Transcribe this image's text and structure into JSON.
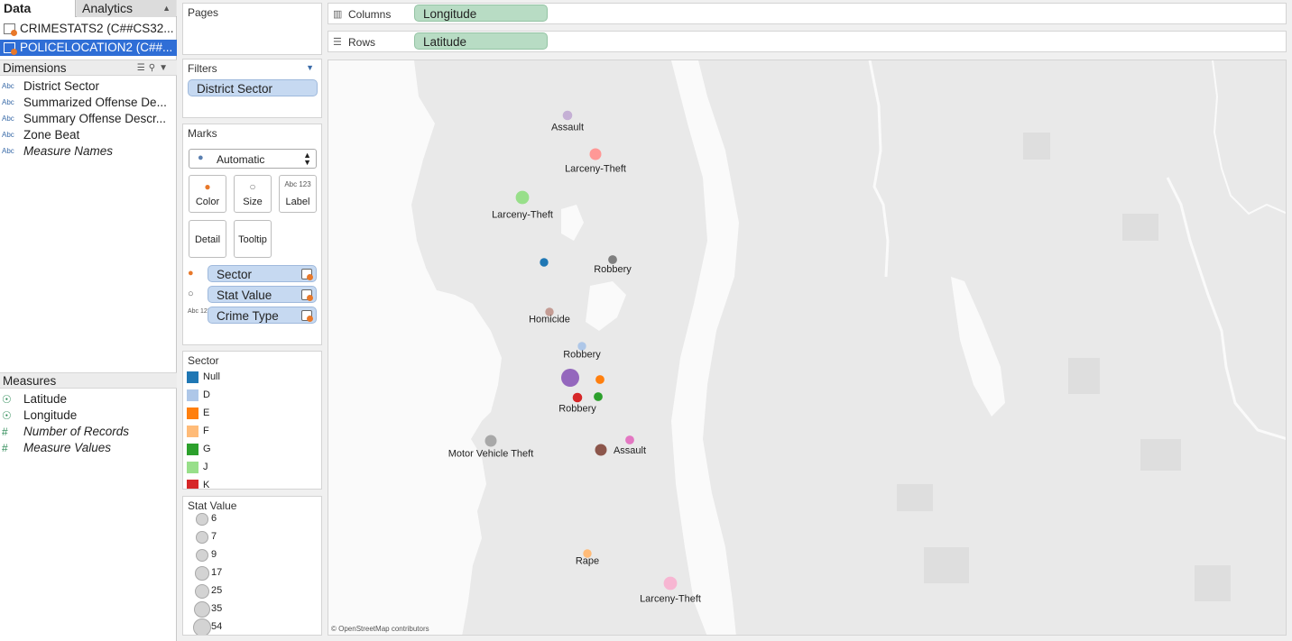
{
  "tabs": {
    "data": "Data",
    "analytics": "Analytics"
  },
  "datasources": [
    "CRIMESTATS2 (C##CS32...",
    "POLICELOCATION2 (C##..."
  ],
  "dimensions": {
    "header": "Dimensions",
    "items": [
      {
        "type": "Abc",
        "label": "District Sector"
      },
      {
        "type": "Abc",
        "label": "Summarized Offense De..."
      },
      {
        "type": "Abc",
        "label": "Summary Offense Descr..."
      },
      {
        "type": "Abc",
        "label": "Zone Beat"
      },
      {
        "type": "Abc",
        "label": "Measure Names"
      }
    ]
  },
  "measures": {
    "header": "Measures",
    "items": [
      {
        "type": "globe",
        "label": "Latitude"
      },
      {
        "type": "globe",
        "label": "Longitude"
      },
      {
        "type": "#",
        "label": "Number of Records"
      },
      {
        "type": "#",
        "label": "Measure Values"
      }
    ]
  },
  "pages": {
    "title": "Pages"
  },
  "filters": {
    "title": "Filters",
    "pill": "District Sector"
  },
  "marks": {
    "title": "Marks",
    "type": "Automatic",
    "buttons": [
      "Color",
      "Size",
      "Label",
      "Detail",
      "Tooltip"
    ],
    "label_icon": "Abc 123",
    "shelf": [
      {
        "icon": "color-icon",
        "label": "Sector"
      },
      {
        "icon": "size-icon",
        "label": "Stat Value"
      },
      {
        "icon": "Abc 123",
        "label": "Crime Type"
      }
    ]
  },
  "sector_legend": {
    "title": "Sector",
    "items": [
      {
        "label": "Null",
        "color": "#1f77b4"
      },
      {
        "label": "D",
        "color": "#aec7e8"
      },
      {
        "label": "E",
        "color": "#ff7f0e"
      },
      {
        "label": "F",
        "color": "#ffbb78"
      },
      {
        "label": "G",
        "color": "#2ca02c"
      },
      {
        "label": "J",
        "color": "#98df8a"
      },
      {
        "label": "K",
        "color": "#d62728"
      }
    ]
  },
  "size_legend": {
    "title": "Stat Value",
    "items": [
      "6",
      "7",
      "9",
      "17",
      "25",
      "35",
      "54"
    ]
  },
  "shelves": {
    "columns_label": "Columns",
    "columns_pill": "Longitude",
    "rows_label": "Rows",
    "rows_pill": "Latitude"
  },
  "map": {
    "credit": "© OpenStreetMap contributors",
    "marks": [
      {
        "label": "Assault",
        "color": "#c5b0d5",
        "value": 9
      },
      {
        "label": "Larceny-Theft",
        "color": "#ff9896",
        "value": 17
      },
      {
        "label": "Larceny-Theft",
        "color": "#98df8a",
        "value": 25
      },
      {
        "label": "",
        "color": "#1f77b4",
        "value": 6
      },
      {
        "label": "Robbery",
        "color": "#7f7f7f",
        "value": 7
      },
      {
        "label": "Homicide",
        "color": "#c49c94",
        "value": 6
      },
      {
        "label": "Robbery",
        "color": "#aec7e8",
        "value": 6
      },
      {
        "label": "",
        "color": "#9467bd",
        "value": 54
      },
      {
        "label": "",
        "color": "#ff7f0e",
        "value": 7
      },
      {
        "label": "Robbery",
        "color": "#d62728",
        "value": 9
      },
      {
        "label": "",
        "color": "#2ca02c",
        "value": 7
      },
      {
        "label": "Motor Vehicle Theft",
        "color": "#a8a8a8",
        "value": 17
      },
      {
        "label": "",
        "color": "#8c564b",
        "value": 17
      },
      {
        "label": "Assault",
        "color": "#e377c2",
        "value": 7
      },
      {
        "label": "Rape",
        "color": "#ffbb78",
        "value": 6
      },
      {
        "label": "Larceny-Theft",
        "color": "#f7b6d2",
        "value": 25
      }
    ]
  }
}
